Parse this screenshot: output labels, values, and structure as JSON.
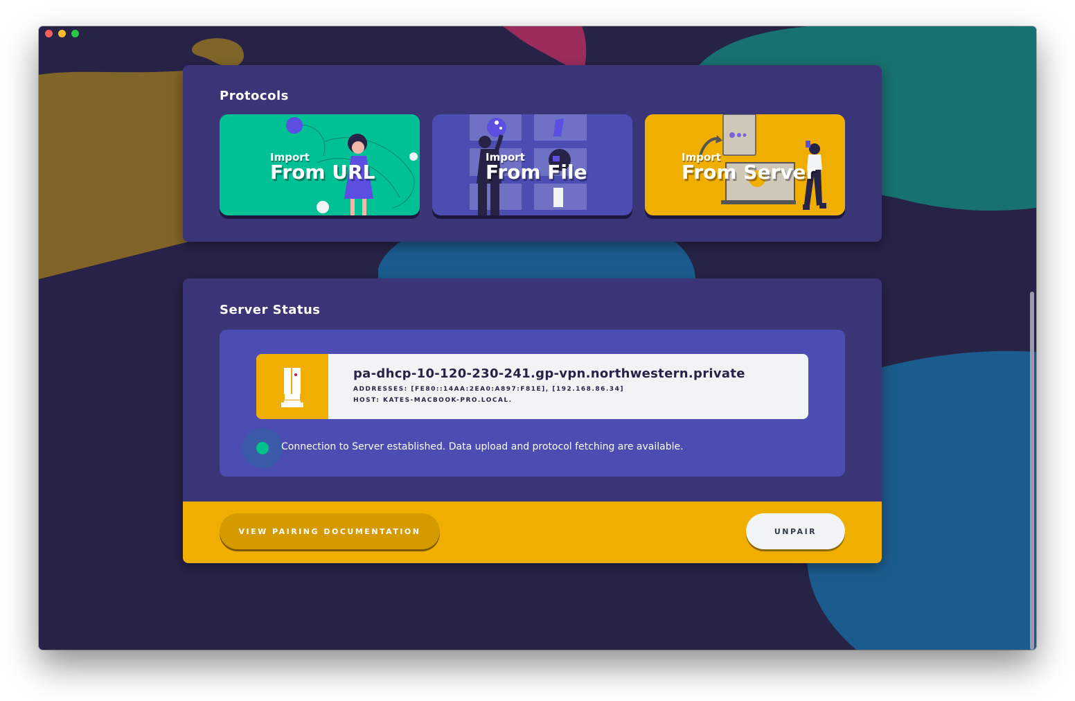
{
  "window": {
    "controls": [
      "close",
      "minimize",
      "zoom"
    ]
  },
  "protocols": {
    "title": "Protocols",
    "cards": [
      {
        "small": "Import",
        "large": "From URL",
        "color": "#00c095"
      },
      {
        "small": "Import",
        "large": "From File",
        "color": "#4b4db2"
      },
      {
        "small": "Import",
        "large": "From Server",
        "color": "#f0ae00"
      }
    ]
  },
  "server_status": {
    "title": "Server Status",
    "server": {
      "name": "pa-dhcp-10-120-230-241.gp-vpn.northwestern.private",
      "addresses": "ADDRESSES: [FE80::14AA:2EA0:A897:F81E], [192.168.86.34]",
      "host": "HOST: KATES-MACBOOK-PRO.LOCAL."
    },
    "connection": {
      "status_color": "#00c08b",
      "message": "Connection to Server established. Data upload and protocol fetching are available."
    }
  },
  "footer": {
    "docs_button": "VIEW PAIRING DOCUMENTATION",
    "unpair_button": "UNPAIR"
  },
  "colors": {
    "background": "#262347",
    "panel": "#393577",
    "accent_yellow": "#f0ae00",
    "accent_teal": "#00c095",
    "accent_blue": "#4b4db2"
  }
}
